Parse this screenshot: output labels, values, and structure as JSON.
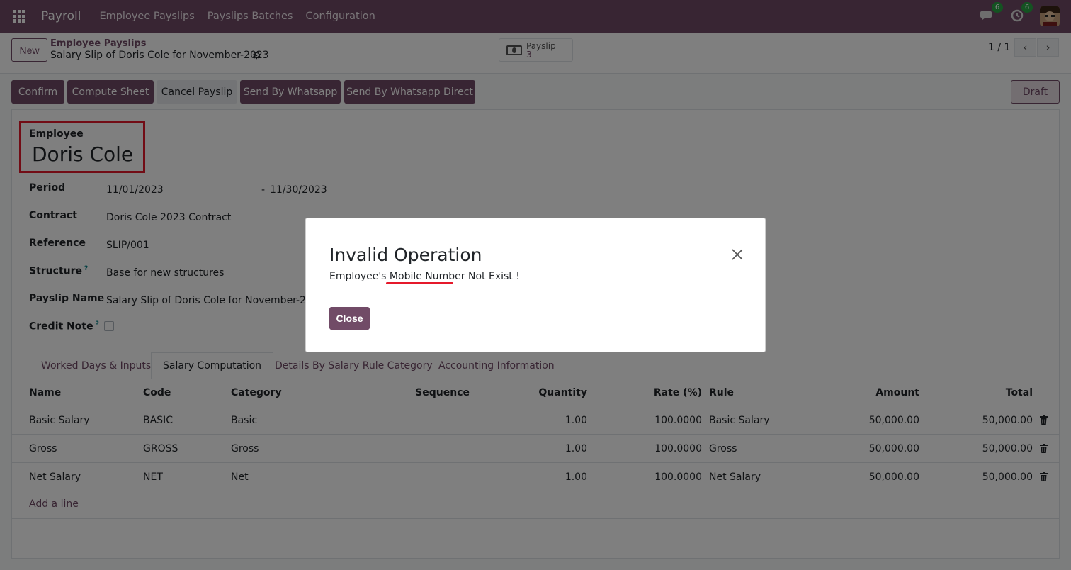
{
  "nav": {
    "app_name": "Payroll",
    "menu": [
      "Employee Payslips",
      "Payslips Batches",
      "Configuration"
    ],
    "messages_badge": "6",
    "activities_badge": "6"
  },
  "control": {
    "new_label": "New",
    "breadcrumb_parent": "Employee Payslips",
    "breadcrumb_current": "Salary Slip of Doris Cole for November-2023",
    "smart_button": {
      "label": "Payslip",
      "count": "3"
    },
    "pager": "1 / 1"
  },
  "status": {
    "buttons": [
      "Confirm",
      "Compute Sheet",
      "Cancel Payslip",
      "Send By Whatsapp",
      "Send By Whatsapp Direct"
    ],
    "state": "Draft"
  },
  "form": {
    "employee_label": "Employee",
    "employee_name": "Doris Cole",
    "fields": {
      "period_label": "Period",
      "period_from": "11/01/2023",
      "period_sep": "-",
      "period_to": "11/30/2023",
      "contract_label": "Contract",
      "contract_value": "Doris Cole 2023 Contract",
      "reference_label": "Reference",
      "reference_value": "SLIP/001",
      "structure_label": "Structure",
      "structure_value": "Base for new structures",
      "payslip_name_label": "Payslip Name",
      "payslip_name_value": "Salary Slip of Doris Cole for November-2023",
      "credit_note_label": "Credit Note",
      "help_mark": "?"
    }
  },
  "tabs": [
    "Worked Days & Inputs",
    "Salary Computation",
    "Details By Salary Rule Category",
    "Accounting Information"
  ],
  "table": {
    "headers": [
      "Name",
      "Code",
      "Category",
      "Sequence",
      "Quantity",
      "Rate (%)",
      "Rule",
      "Amount",
      "Total"
    ],
    "rows": [
      {
        "name": "Basic Salary",
        "code": "BASIC",
        "category": "Basic",
        "sequence": "",
        "quantity": "1.00",
        "rate": "100.0000",
        "rule": "Basic Salary",
        "amount": "50,000.00",
        "total": "50,000.00"
      },
      {
        "name": "Gross",
        "code": "GROSS",
        "category": "Gross",
        "sequence": "",
        "quantity": "1.00",
        "rate": "100.0000",
        "rule": "Gross",
        "amount": "50,000.00",
        "total": "50,000.00"
      },
      {
        "name": "Net Salary",
        "code": "NET",
        "category": "Net",
        "sequence": "",
        "quantity": "1.00",
        "rate": "100.0000",
        "rule": "Net Salary",
        "amount": "50,000.00",
        "total": "50,000.00"
      }
    ],
    "add_line": "Add a line"
  },
  "dialog": {
    "title": "Invalid Operation",
    "message": "Employee's Mobile Number Not Exist !",
    "close_label": "Close"
  },
  "colors": {
    "brand": "#714b67",
    "highlight": "#e5192b",
    "badge": "#28a745"
  }
}
